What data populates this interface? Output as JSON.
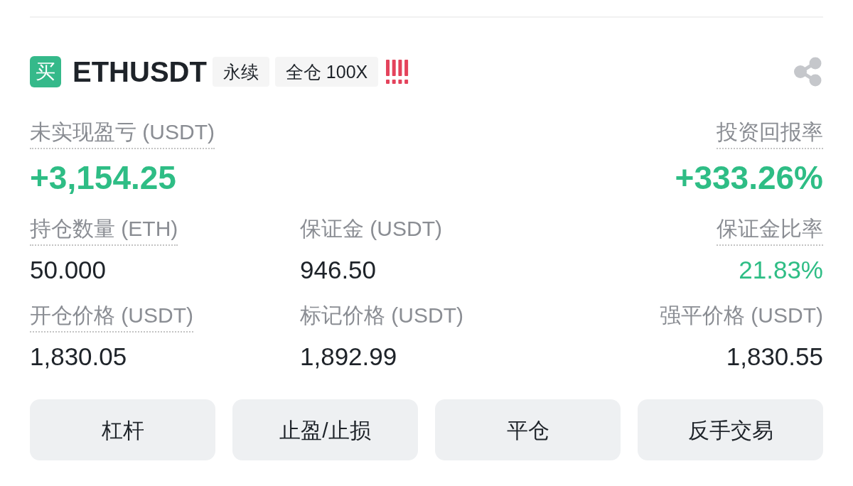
{
  "header": {
    "side_badge": "买",
    "symbol": "ETHUSDT",
    "tags": [
      "永续",
      "全仓 100X"
    ]
  },
  "stat_rows": [
    {
      "kind": "headline",
      "items": [
        {
          "label": "未实现盈亏 (USDT)",
          "has_tooltip": true,
          "value": "+3,154.25",
          "color": "#2ebd85"
        },
        {
          "label": "投资回报率",
          "has_tooltip": true,
          "value": "+333.26%",
          "color": "#2ebd85"
        }
      ]
    },
    {
      "kind": "detail",
      "items": [
        {
          "label": "持仓数量 (ETH)",
          "has_tooltip": true,
          "value": "50.000",
          "color": "#1e2329"
        },
        {
          "label": "保证金 (USDT)",
          "has_tooltip": false,
          "value": "946.50",
          "color": "#1e2329"
        },
        {
          "label": "保证金比率",
          "has_tooltip": true,
          "value": "21.83%",
          "color": "#2ebd85"
        }
      ]
    },
    {
      "kind": "detail",
      "items": [
        {
          "label": "开仓价格 (USDT)",
          "has_tooltip": true,
          "value": "1,830.05",
          "color": "#1e2329"
        },
        {
          "label": "标记价格 (USDT)",
          "has_tooltip": false,
          "value": "1,892.99",
          "color": "#1e2329"
        },
        {
          "label": "强平价格 (USDT)",
          "has_tooltip": false,
          "value": "1,830.55",
          "color": "#1e2329"
        }
      ]
    }
  ],
  "buttons": [
    "杠杆",
    "止盈/止损",
    "平仓",
    "反手交易"
  ]
}
